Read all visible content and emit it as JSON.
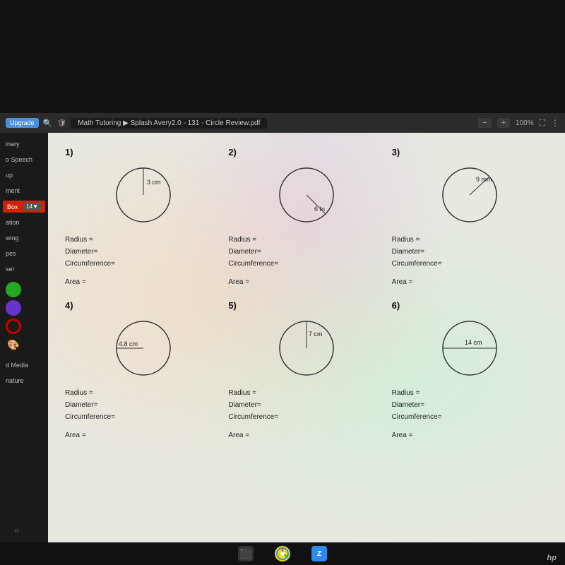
{
  "browser": {
    "tab_title": "Math Tutoring  ▶  Splash Avery2.0 - 131 - Circle Review.pdf",
    "zoom": "100%",
    "upgrade_label": "Upgrade"
  },
  "sidebar": {
    "items": [
      {
        "id": "inary",
        "label": "inary"
      },
      {
        "id": "o-speech",
        "label": "o Speech"
      },
      {
        "id": "up",
        "label": "up"
      },
      {
        "id": "ment",
        "label": "ment"
      },
      {
        "id": "box",
        "label": "Box",
        "badge": "14"
      },
      {
        "id": "ation",
        "label": "ation"
      },
      {
        "id": "wing",
        "label": "wing"
      },
      {
        "id": "pes",
        "label": "pes"
      },
      {
        "id": "ser",
        "label": "ser"
      },
      {
        "id": "d-media",
        "label": "d Media"
      },
      {
        "id": "nature",
        "label": "nature"
      }
    ],
    "colors": [
      "#22aa22",
      "#6633cc",
      "#cc0000"
    ],
    "palette": "🎨"
  },
  "worksheet": {
    "problems": [
      {
        "number": "1)",
        "measurement_label": "3 cm",
        "measurement_type": "radius",
        "radius": "3 cm",
        "fields": {
          "radius": "Radius =",
          "diameter": "Diameter=",
          "circumference": "Circumference=",
          "area": "Area ="
        }
      },
      {
        "number": "2)",
        "measurement_label": "6 In",
        "measurement_type": "diagonal",
        "radius": "6 In",
        "fields": {
          "radius": "Radius =",
          "diameter": "Diameter=",
          "circumference": "Circumference=",
          "area": "Area ="
        }
      },
      {
        "number": "3)",
        "measurement_label": "9 mm",
        "measurement_type": "radius",
        "radius": "9 mm",
        "fields": {
          "radius": "Radius =",
          "diameter": "Diameter=",
          "circumference": "Circumference=",
          "area": "Area ="
        }
      },
      {
        "number": "4)",
        "measurement_label": "4.8 cm",
        "measurement_type": "radius",
        "radius": "4.8 cm",
        "fields": {
          "radius": "Radius =",
          "diameter": "Diameter=",
          "circumference": "Circumference=",
          "area": "Area ="
        }
      },
      {
        "number": "5)",
        "measurement_label": "7 cm",
        "measurement_type": "radius",
        "radius": "7 cm",
        "fields": {
          "radius": "Radius =",
          "diameter": "Diameter=",
          "circumference": "Circumference=",
          "area": "Area ="
        }
      },
      {
        "number": "6)",
        "measurement_label": "14 cm",
        "measurement_type": "diameter",
        "radius": "14 cm",
        "fields": {
          "radius": "Radius =",
          "diameter": "Diameter=",
          "circumference": "Circumference=",
          "area": "Area ="
        }
      }
    ]
  },
  "taskbar": {
    "icons": [
      "⬛",
      "🌐",
      "📹"
    ]
  },
  "hp_logo": "hp"
}
